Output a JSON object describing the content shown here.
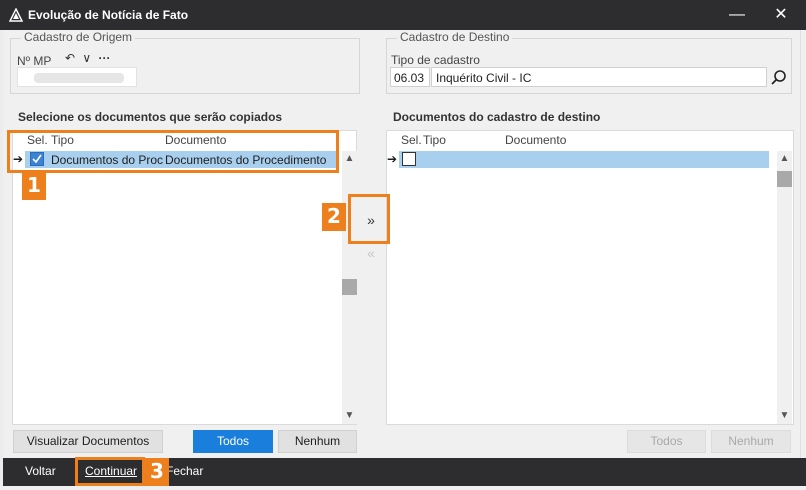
{
  "window": {
    "title": "Evolução de Notícia de Fato",
    "minimize_glyph": "—",
    "close_glyph": "✕"
  },
  "origem": {
    "group_title": "Cadastro de Origem",
    "mp_label": "Nº MP",
    "undo_glyph": "↶",
    "dropdown_glyph": "∨",
    "more_glyph": "···"
  },
  "destino": {
    "group_title": "Cadastro de Destino",
    "tipo_label": "Tipo de cadastro",
    "tipo_code": "06.03",
    "tipo_desc": "Inquérito Civil - IC"
  },
  "left_panel": {
    "title": "Selecione os documentos que serão copiados",
    "columns": {
      "sel": "Sel.",
      "tipo": "Tipo",
      "documento": "Documento"
    },
    "rows": [
      {
        "tipo": "Documentos  do Procedimento",
        "documento": "Documentos  do Procedimento",
        "checked": true
      }
    ]
  },
  "right_panel": {
    "title": "Documentos do cadastro de destino",
    "columns": {
      "sel": "Sel.",
      "tipo": "Tipo",
      "documento": "Documento"
    }
  },
  "buttons": {
    "visualizar": "Visualizar Documentos",
    "todos": "Todos",
    "nenhum": "Nenhum",
    "todos_right": "Todos",
    "nenhum_right": "Nenhum",
    "transfer_right": "»",
    "transfer_left": "«"
  },
  "footer": {
    "voltar": "Voltar",
    "continuar": "Continuar",
    "fechar": "Fechar"
  },
  "callouts": [
    "1",
    "2",
    "3"
  ],
  "colors": {
    "titlebar": "#2d2d30",
    "accent": "#1a7fdc",
    "selection": "#a9cfee",
    "callout": "#ee7f1d"
  }
}
